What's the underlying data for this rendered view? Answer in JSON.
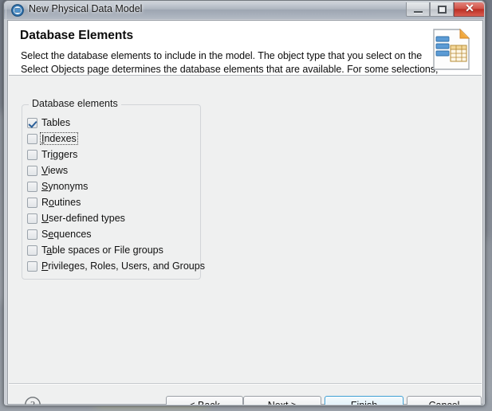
{
  "window": {
    "title": "New Physical Data Model",
    "app_icon": "database-model-icon",
    "controls": {
      "minimize": "Minimize",
      "maximize": "Restore",
      "close": "Close",
      "close_glyph": "✕"
    }
  },
  "header": {
    "title": "Database Elements",
    "description": "Select the database elements to include in the model. The object type that you select on the Select Objects page determines the database elements that are available. For some selections, required",
    "graphic": "data-model-document-icon"
  },
  "group": {
    "legend": "Database elements",
    "items": [
      {
        "label": "Tables",
        "pre": "T",
        "mnemonic": "",
        "post": "ables",
        "checked": true,
        "focused": false
      },
      {
        "label": "Indexes",
        "pre": "",
        "mnemonic": "I",
        "post": "ndexes",
        "checked": false,
        "focused": true
      },
      {
        "label": "Triggers",
        "pre": "Tr",
        "mnemonic": "i",
        "post": "ggers",
        "checked": false,
        "focused": false
      },
      {
        "label": "Views",
        "pre": "",
        "mnemonic": "V",
        "post": "iews",
        "checked": false,
        "focused": false
      },
      {
        "label": "Synonyms",
        "pre": "",
        "mnemonic": "S",
        "post": "ynonyms",
        "checked": false,
        "focused": false
      },
      {
        "label": "Routines",
        "pre": "R",
        "mnemonic": "o",
        "post": "utines",
        "checked": false,
        "focused": false
      },
      {
        "label": "User-defined types",
        "pre": "",
        "mnemonic": "U",
        "post": "ser-defined types",
        "checked": false,
        "focused": false
      },
      {
        "label": "Sequences",
        "pre": "S",
        "mnemonic": "e",
        "post": "quences",
        "checked": false,
        "focused": false
      },
      {
        "label": "Table spaces or File groups",
        "pre": "T",
        "mnemonic": "a",
        "post": "ble spaces or File groups",
        "checked": false,
        "focused": false
      },
      {
        "label": "Privileges, Roles, Users, and Groups",
        "pre": "",
        "mnemonic": "P",
        "post": "rivileges, Roles, Users, and Groups",
        "checked": false,
        "focused": false
      }
    ]
  },
  "footer": {
    "help": "?",
    "back": {
      "label": "< Back",
      "pre": "< ",
      "mnemonic": "B",
      "post": "ack"
    },
    "next": {
      "label": "Next >",
      "pre": "",
      "mnemonic": "N",
      "post": "ext >"
    },
    "finish": {
      "label": "Finish",
      "pre": "",
      "mnemonic": "F",
      "post": "inish",
      "default": true
    },
    "cancel": {
      "label": "Cancel",
      "pre": "",
      "mnemonic": "",
      "post": "Cancel"
    }
  },
  "colors": {
    "accent_blue": "#3c9fd4",
    "close_red": "#d2564b",
    "check_blue": "#2b5f99",
    "header_bg": "#ffffff",
    "dialog_bg": "#eff0f0"
  }
}
